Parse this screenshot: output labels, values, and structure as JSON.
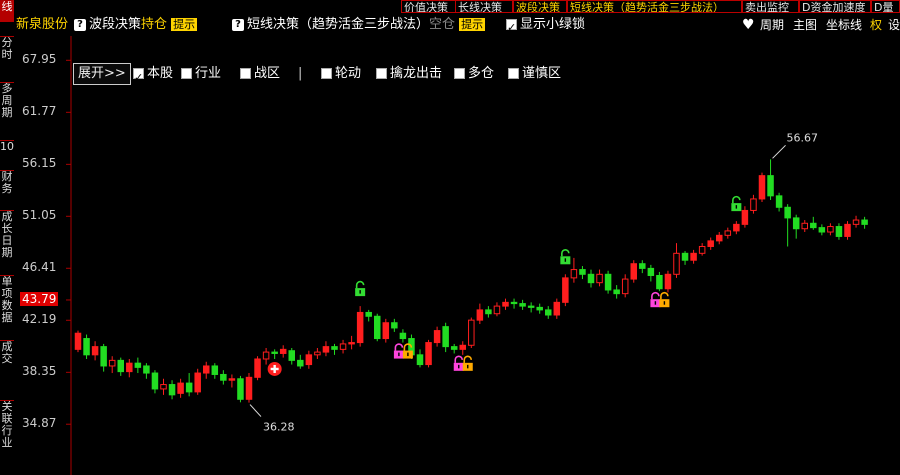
{
  "top_tabs": [
    {
      "label": "价值决策",
      "color": "white"
    },
    {
      "label": "长线决策",
      "color": "white"
    },
    {
      "label": "波段决策",
      "color": "yellow"
    },
    {
      "label": "短线决策（趋势活金三步战法）",
      "color": "yellow"
    },
    {
      "label": "卖出监控",
      "color": "white"
    },
    {
      "label": "D资金加速度",
      "color": "white"
    },
    {
      "label": "D量",
      "color": "white"
    }
  ],
  "sidebar": {
    "items": [
      {
        "label": "线",
        "active": true
      },
      {
        "label": "分时"
      },
      {
        "label": "多周期"
      },
      {
        "label": "10"
      },
      {
        "label": "财务"
      },
      {
        "label": "成长日期"
      },
      {
        "label": "单项数据"
      },
      {
        "label": "成交"
      },
      {
        "label": "关联行业"
      }
    ]
  },
  "toolbar": {
    "stock_name": "新泉股份",
    "band_strategy_label": "波段决策",
    "band_hold": "持仓",
    "tip_label": "提示",
    "short_strategy_label": "短线决策（趋势活金三步战法）",
    "short_status": "空仓",
    "show_lock_label": "显示小绿锁",
    "right_tools": [
      "周期",
      "主图",
      "坐标线",
      "权",
      "设"
    ]
  },
  "filter_bar": {
    "expand_label": "展开>>",
    "items": [
      {
        "label": "本股",
        "checked": true
      },
      {
        "label": "行业",
        "checked": false
      },
      {
        "label": "战区",
        "checked": false
      },
      {
        "label": "|",
        "separator": true
      },
      {
        "label": "轮动",
        "checked": false
      },
      {
        "label": "擒龙出击",
        "checked": false
      },
      {
        "label": "多仓",
        "checked": false
      },
      {
        "label": "谨慎区",
        "checked": false
      }
    ]
  },
  "y_axis": {
    "ticks": [
      "67.95",
      "61.77",
      "56.15",
      "51.05",
      "46.41",
      "43.79",
      "42.19",
      "38.35",
      "34.87"
    ],
    "current_price": "43.79"
  },
  "annotations": {
    "high": "56.67",
    "low": "36.28"
  },
  "colors": {
    "up": "#ff1e1e",
    "down": "#22dd22",
    "lock_green": "#33dd33",
    "lock_pink": "#ff44dd",
    "lock_orange": "#ffaa00",
    "current_bg": "#e00000",
    "axis": "#aa0000"
  },
  "chart_data": {
    "type": "candlestick",
    "y_scale": "log",
    "candles": [
      [
        40.0,
        41.2,
        39.8,
        41.4
      ],
      [
        40.8,
        39.6,
        39.3,
        41.1
      ],
      [
        39.6,
        40.2,
        39.2,
        40.6
      ],
      [
        40.2,
        38.8,
        38.4,
        40.4
      ],
      [
        38.8,
        39.2,
        38.3,
        39.5
      ],
      [
        39.2,
        38.4,
        38.1,
        39.4
      ],
      [
        38.4,
        39.0,
        38.0,
        39.3
      ],
      [
        39.0,
        38.7,
        38.3,
        39.4
      ],
      [
        38.8,
        38.3,
        37.9,
        39.0
      ],
      [
        38.3,
        37.2,
        36.9,
        38.5
      ],
      [
        37.2,
        37.5,
        36.8,
        37.9
      ],
      [
        37.5,
        36.8,
        36.5,
        37.8
      ],
      [
        36.9,
        37.6,
        36.6,
        37.9
      ],
      [
        37.6,
        37.0,
        36.7,
        38.3
      ],
      [
        37.0,
        38.3,
        36.8,
        38.6
      ],
      [
        38.3,
        38.8,
        37.9,
        39.1
      ],
      [
        38.8,
        38.2,
        37.9,
        39.0
      ],
      [
        38.2,
        37.8,
        37.5,
        38.5
      ],
      [
        37.8,
        37.9,
        37.3,
        38.2
      ],
      [
        37.9,
        36.5,
        36.3,
        38.1
      ],
      [
        36.5,
        38.0,
        36.28,
        38.3
      ],
      [
        38.0,
        39.3,
        37.8,
        39.5
      ],
      [
        39.3,
        39.8,
        38.9,
        40.1
      ],
      [
        39.8,
        39.7,
        39.3,
        40.0
      ],
      [
        39.7,
        40.0,
        39.4,
        40.3
      ],
      [
        39.9,
        39.2,
        38.9,
        40.1
      ],
      [
        39.2,
        38.8,
        38.6,
        39.6
      ],
      [
        38.9,
        39.6,
        38.6,
        39.9
      ],
      [
        39.6,
        39.8,
        39.3,
        40.1
      ],
      [
        39.8,
        40.2,
        39.5,
        40.6
      ],
      [
        40.2,
        40.0,
        39.6,
        40.4
      ],
      [
        40.0,
        40.4,
        39.7,
        40.7
      ],
      [
        40.4,
        40.5,
        40.0,
        41.0
      ],
      [
        40.5,
        42.8,
        40.2,
        43.3
      ],
      [
        42.8,
        42.5,
        42.1,
        43.0
      ],
      [
        42.5,
        40.8,
        40.6,
        42.7
      ],
      [
        40.8,
        42.0,
        40.5,
        42.3
      ],
      [
        42.0,
        41.6,
        41.3,
        42.3
      ],
      [
        41.2,
        40.8,
        40.5,
        41.5
      ],
      [
        40.8,
        39.6,
        39.3,
        41.1
      ],
      [
        39.6,
        38.9,
        38.7,
        40.0
      ],
      [
        38.9,
        40.5,
        38.7,
        40.7
      ],
      [
        40.5,
        41.4,
        40.2,
        41.7
      ],
      [
        41.7,
        40.2,
        39.8,
        42.0
      ],
      [
        40.2,
        40.0,
        39.7,
        40.4
      ],
      [
        40.0,
        40.3,
        39.6,
        40.6
      ],
      [
        40.3,
        42.2,
        40.1,
        42.4
      ],
      [
        42.2,
        43.0,
        41.9,
        43.5
      ],
      [
        43.0,
        42.7,
        42.4,
        43.3
      ],
      [
        42.7,
        43.3,
        42.5,
        43.6
      ],
      [
        43.3,
        43.6,
        43.0,
        43.9
      ],
      [
        43.6,
        43.5,
        43.1,
        43.9
      ],
      [
        43.5,
        43.3,
        43.0,
        43.8
      ],
      [
        43.3,
        43.2,
        42.8,
        43.6
      ],
      [
        43.2,
        43.0,
        42.7,
        43.5
      ],
      [
        43.0,
        42.6,
        42.3,
        43.3
      ],
      [
        42.6,
        43.6,
        42.3,
        43.9
      ],
      [
        43.6,
        45.6,
        43.3,
        45.9
      ],
      [
        45.6,
        46.3,
        45.2,
        47.3
      ],
      [
        46.3,
        45.9,
        45.5,
        46.6
      ],
      [
        45.9,
        45.2,
        44.8,
        46.3
      ],
      [
        45.2,
        45.9,
        44.9,
        46.3
      ],
      [
        45.9,
        44.6,
        44.3,
        46.2
      ],
      [
        44.6,
        44.3,
        43.9,
        45.0
      ],
      [
        44.3,
        45.5,
        44.0,
        45.9
      ],
      [
        45.5,
        46.8,
        45.2,
        47.1
      ],
      [
        46.8,
        46.4,
        46.0,
        47.1
      ],
      [
        46.4,
        45.8,
        45.3,
        46.7
      ],
      [
        45.8,
        44.7,
        44.5,
        46.1
      ],
      [
        44.7,
        45.9,
        44.4,
        46.2
      ],
      [
        45.9,
        47.7,
        45.6,
        48.6
      ],
      [
        47.7,
        47.1,
        46.7,
        47.9
      ],
      [
        47.1,
        47.7,
        46.8,
        48.0
      ],
      [
        47.7,
        48.3,
        47.5,
        48.6
      ],
      [
        48.3,
        48.8,
        48.0,
        49.1
      ],
      [
        48.8,
        49.3,
        48.5,
        49.6
      ],
      [
        49.3,
        49.7,
        49.0,
        50.0
      ],
      [
        49.7,
        50.3,
        49.4,
        50.6
      ],
      [
        50.3,
        51.6,
        50.0,
        52.0
      ],
      [
        51.6,
        52.7,
        51.3,
        53.1
      ],
      [
        52.7,
        55.0,
        52.4,
        55.3
      ],
      [
        55.0,
        53.0,
        52.6,
        56.67
      ],
      [
        53.0,
        51.9,
        51.5,
        53.3
      ],
      [
        51.9,
        50.9,
        48.3,
        52.2
      ],
      [
        50.9,
        49.9,
        49.0,
        51.2
      ],
      [
        49.9,
        50.4,
        49.6,
        50.7
      ],
      [
        50.4,
        50.0,
        49.8,
        51.0
      ],
      [
        50.0,
        49.6,
        49.3,
        50.3
      ],
      [
        49.6,
        50.1,
        49.3,
        50.4
      ],
      [
        50.1,
        49.2,
        48.9,
        50.4
      ],
      [
        49.2,
        50.3,
        48.9,
        50.6
      ],
      [
        50.3,
        50.7,
        50.0,
        51.1
      ],
      [
        50.7,
        50.3,
        49.9,
        51.0
      ]
    ],
    "ylim": [
      34.0,
      69.5
    ],
    "markers": [
      {
        "type": "lock",
        "color": "green",
        "candle": 33
      },
      {
        "type": "lock",
        "color": "green",
        "candle": 57
      },
      {
        "type": "lock",
        "color": "green",
        "candle": 77
      },
      {
        "type": "lock-pair",
        "color": "pink-orange",
        "candle": 38
      },
      {
        "type": "lock-pair",
        "color": "pink-orange",
        "candle": 45
      },
      {
        "type": "lock-pair",
        "color": "pink-orange",
        "candle": 68
      },
      {
        "type": "plus",
        "color": "red",
        "candle": 23
      }
    ]
  }
}
